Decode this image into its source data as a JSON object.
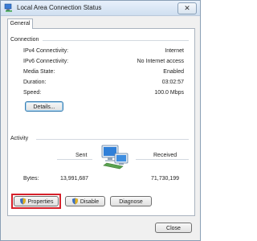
{
  "window": {
    "title": "Local Area Connection Status",
    "close_glyph": "✕"
  },
  "tabs": [
    {
      "label": "General"
    }
  ],
  "connection": {
    "heading": "Connection",
    "rows": [
      {
        "label": "IPv4 Connectivity:",
        "value": "Internet"
      },
      {
        "label": "IPv6 Connectivity:",
        "value": "No Internet access"
      },
      {
        "label": "Media State:",
        "value": "Enabled"
      },
      {
        "label": "Duration:",
        "value": "03:02:57"
      },
      {
        "label": "Speed:",
        "value": "100.0 Mbps"
      }
    ],
    "details_button": "Details..."
  },
  "activity": {
    "heading": "Activity",
    "sent_label": "Sent",
    "received_label": "Received",
    "bytes_label": "Bytes:",
    "bytes_sent": "13,991,687",
    "bytes_received": "71,730,199",
    "icon": "network-computers-icon"
  },
  "buttons": {
    "properties": "Properties",
    "disable": "Disable",
    "diagnose": "Diagnose",
    "close": "Close"
  },
  "colors": {
    "highlight": "#d6202a",
    "accent": "#3c7fb1"
  }
}
